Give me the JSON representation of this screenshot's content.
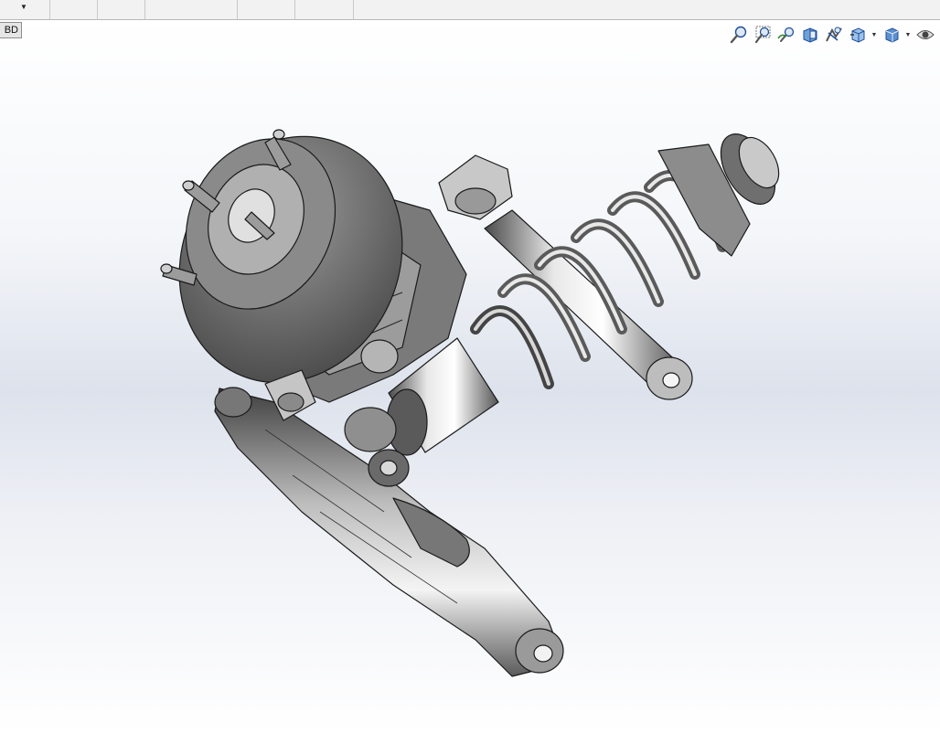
{
  "tabbar": {
    "tabs": [
      "",
      "",
      "",
      "",
      "",
      ""
    ]
  },
  "feature_tree_toggle": {
    "label": "BD"
  },
  "heads_up_toolbar": {
    "tools": [
      {
        "name": "zoom-to-fit",
        "icon": "zoom-to-fit-icon"
      },
      {
        "name": "zoom-to-area",
        "icon": "zoom-to-area-icon"
      },
      {
        "name": "previous-view",
        "icon": "previous-view-icon"
      },
      {
        "name": "section-view",
        "icon": "section-view-icon"
      },
      {
        "name": "dynamic-annotation-views",
        "icon": "dynamic-annotation-icon"
      },
      {
        "name": "view-orientation",
        "icon": "view-orientation-icon",
        "dropdown": true
      },
      {
        "name": "display-style",
        "icon": "display-style-icon",
        "dropdown": true
      },
      {
        "name": "hide-show-items",
        "icon": "hide-show-eye-icon"
      }
    ]
  },
  "colors": {
    "accent": "#1e6fd6",
    "model_fill": "#8a8a8a",
    "model_edge": "#1a1a1a",
    "background_top": "#ffffff",
    "background_mid": "#dde2ec"
  },
  "model": {
    "description_icon": "suspension-assembly"
  }
}
